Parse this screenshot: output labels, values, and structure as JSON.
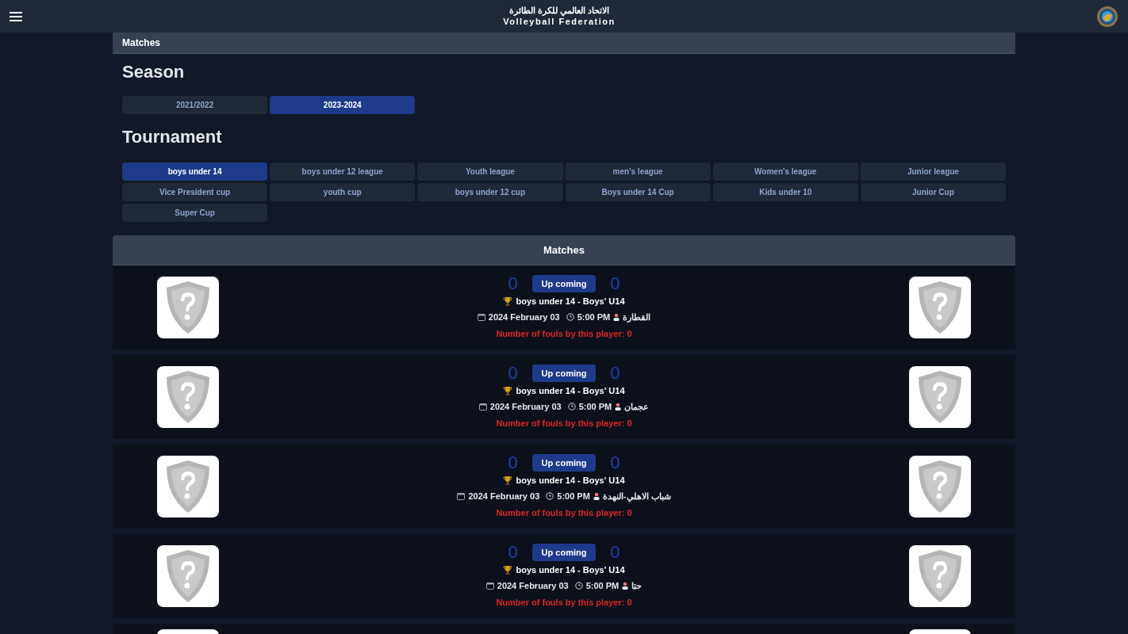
{
  "header": {
    "title_ar": "الاتحاد العالمي للكرة الطائرة",
    "title_en": "Volleyball Federation"
  },
  "breadcrumb": "Matches",
  "season": {
    "heading": "Season",
    "options": [
      {
        "label": "2021/2022",
        "selected": false
      },
      {
        "label": "2023-2024",
        "selected": true
      }
    ]
  },
  "tournament": {
    "heading": "Tournament",
    "options": [
      {
        "label": "boys under 14",
        "selected": true
      },
      {
        "label": "boys under 12 league",
        "selected": false
      },
      {
        "label": "Youth league",
        "selected": false
      },
      {
        "label": "men's league",
        "selected": false
      },
      {
        "label": "Women's league",
        "selected": false
      },
      {
        "label": "Junior league",
        "selected": false
      },
      {
        "label": "Vice President cup",
        "selected": false
      },
      {
        "label": "youth cup",
        "selected": false
      },
      {
        "label": "boys under 12 cup",
        "selected": false
      },
      {
        "label": "Boys under 14 Cup",
        "selected": false
      },
      {
        "label": "Kids under 10",
        "selected": false
      },
      {
        "label": "Junior Cup",
        "selected": false
      },
      {
        "label": "Super Cup",
        "selected": false
      }
    ]
  },
  "matches": {
    "title": "Matches",
    "items": [
      {
        "home_score": "0",
        "status": "Up coming",
        "away_score": "0",
        "tournament": "boys under 14 - Boys' U14",
        "date": "2024 February 03",
        "time": "5:00 PM",
        "venue": "القطارة",
        "fouls": "Number of fouls by this player: 0"
      },
      {
        "home_score": "0",
        "status": "Up coming",
        "away_score": "0",
        "tournament": "boys under 14 - Boys' U14",
        "date": "2024 February 03",
        "time": "5:00 PM",
        "venue": "عجمان",
        "fouls": "Number of fouls by this player: 0"
      },
      {
        "home_score": "0",
        "status": "Up coming",
        "away_score": "0",
        "tournament": "boys under 14 - Boys' U14",
        "date": "2024 February 03",
        "time": "5:00 PM",
        "venue": "شباب الاهلي-النهدة",
        "fouls": "Number of fouls by this player: 0"
      },
      {
        "home_score": "0",
        "status": "Up coming",
        "away_score": "0",
        "tournament": "boys under 14 - Boys' U14",
        "date": "2024 February 03",
        "time": "5:00 PM",
        "venue": "حتا",
        "fouls": "Number of fouls by this player: 0"
      }
    ]
  }
}
